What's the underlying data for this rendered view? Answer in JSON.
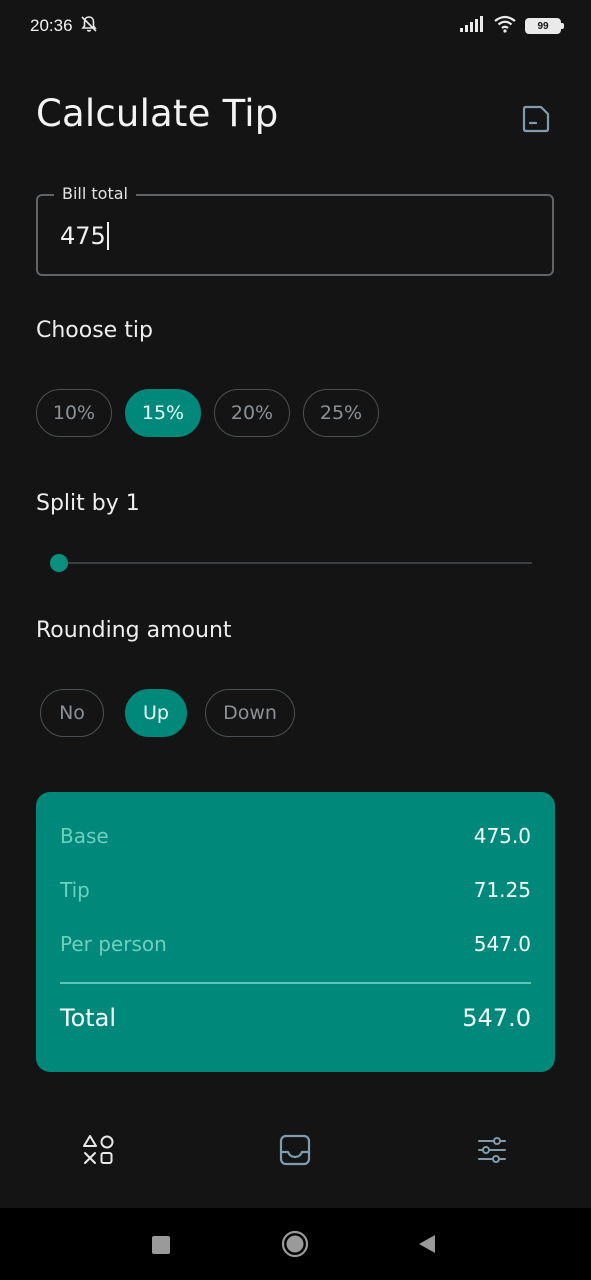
{
  "status_bar": {
    "time": "20:36",
    "battery": "99",
    "icons": [
      "bell-off-icon",
      "signal-icon",
      "wifi-icon",
      "battery-icon"
    ]
  },
  "header": {
    "title": "Calculate Tip",
    "save_icon": "save-icon"
  },
  "bill": {
    "label": "Bill total",
    "value": "475"
  },
  "tip": {
    "label": "Choose tip",
    "options": [
      "10%",
      "15%",
      "20%",
      "25%"
    ],
    "selected": "15%"
  },
  "split": {
    "label": "Split by 1",
    "value": 1
  },
  "rounding": {
    "label": "Rounding amount",
    "options": [
      "No",
      "Up",
      "Down"
    ],
    "selected": "Up"
  },
  "summary": {
    "base_label": "Base",
    "base_value": "475.0",
    "tip_label": "Tip",
    "tip_value": "71.25",
    "per_person_label": "Per person",
    "per_person_value": "547.0",
    "total_label": "Total",
    "total_value": "547.0"
  },
  "bottom_nav": {
    "items": [
      "shapes-icon",
      "inbox-icon",
      "sliders-icon"
    ]
  },
  "system_nav": {
    "items": [
      "recents-square-icon",
      "home-circle-icon",
      "back-triangle-icon"
    ]
  },
  "colors": {
    "background": "#141414",
    "accent": "#00897b",
    "summary_muted_text": "#6fcfbf",
    "outline": "#4a5054"
  }
}
